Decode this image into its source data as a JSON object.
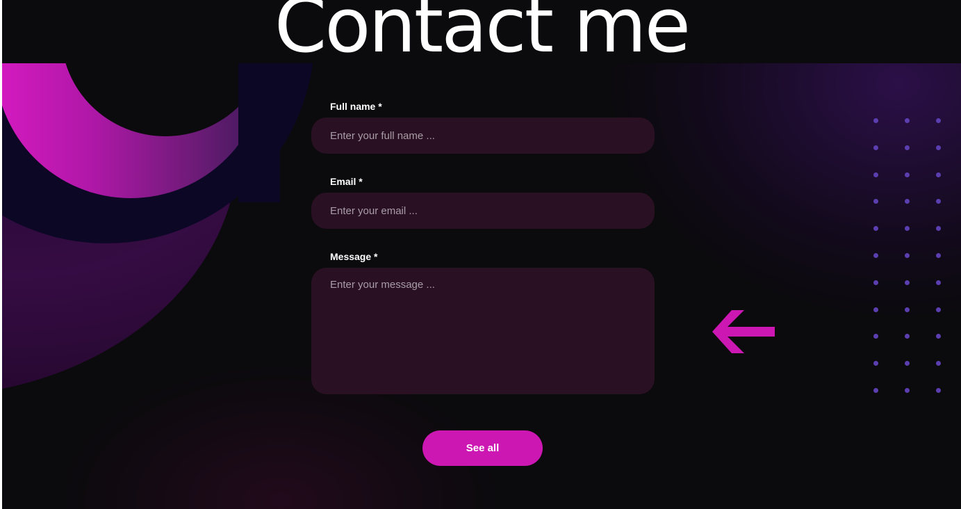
{
  "page": {
    "title": "Contact me"
  },
  "form": {
    "full_name": {
      "label": "Full name *",
      "placeholder": "Enter your full name ..."
    },
    "email": {
      "label": "Email *",
      "placeholder": "Enter your email ..."
    },
    "message": {
      "label": "Message *",
      "placeholder": "Enter your message ..."
    },
    "submit_label": "See all"
  },
  "decor": {
    "arrow_icon": "arrow-left-icon",
    "dots_icon": "dot-grid-icon",
    "accent_color": "#cc17b3",
    "dot_color": "#5b3fb0"
  }
}
